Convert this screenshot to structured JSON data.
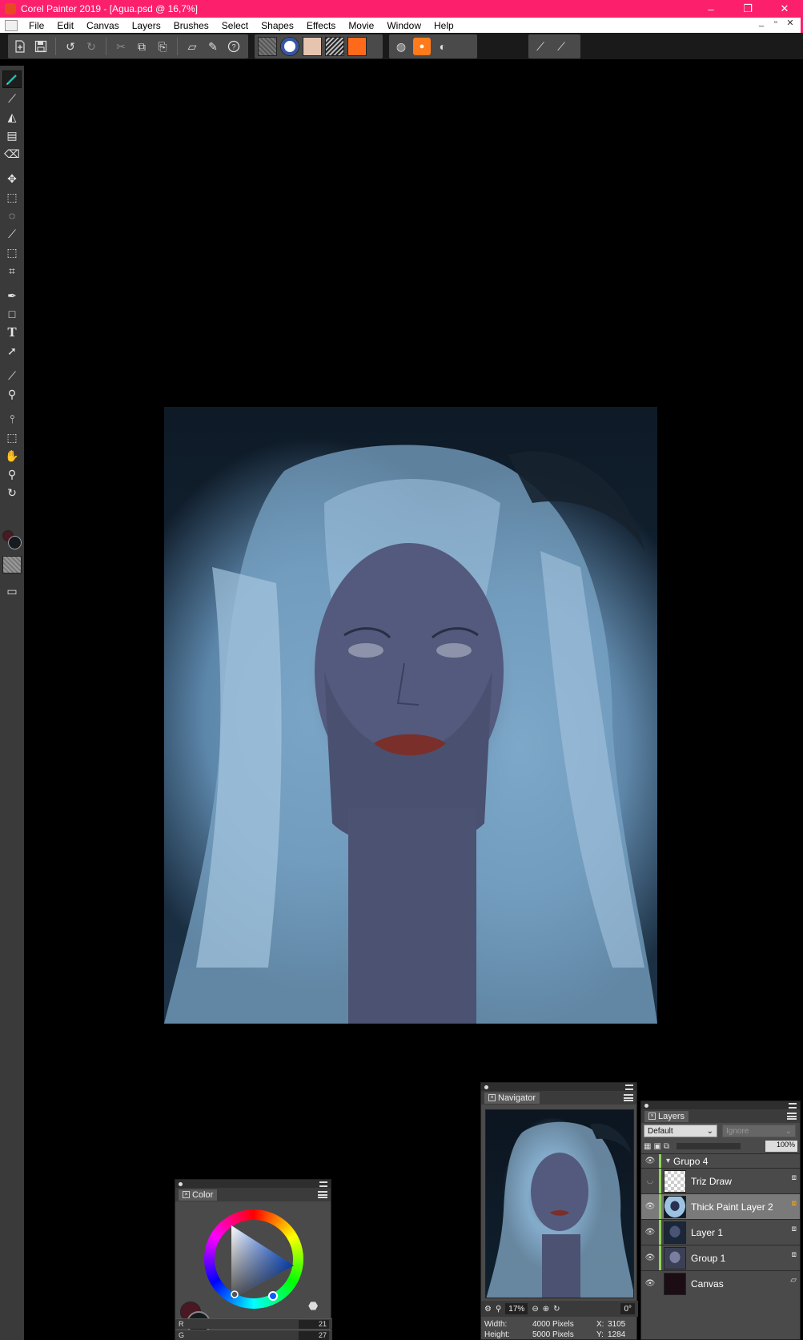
{
  "window": {
    "title": "Corel Painter 2019 - [Agua.psd @ 16,7%]",
    "controls": [
      "–",
      "❐",
      "✕"
    ]
  },
  "menu": [
    "File",
    "Edit",
    "Canvas",
    "Layers",
    "Brushes",
    "Select",
    "Shapes",
    "Effects",
    "Movie",
    "Window",
    "Help"
  ],
  "mdi_controls": [
    "_",
    "▫",
    "✕"
  ],
  "toolbar": {
    "accent_color": "#fb1f6c"
  },
  "color_panel": {
    "tab": "Color",
    "main_color": "#151b1f",
    "secondary_color": "#4a1822",
    "r_label": "R",
    "r_value": "21",
    "g_label": "G",
    "g_value": "27"
  },
  "navigator": {
    "tab": "Navigator",
    "zoom": "17%",
    "rotation": "0°",
    "width_label": "Width:",
    "width_value": "4000 Pixels",
    "height_label": "Height:",
    "height_value": "5000 Pixels",
    "x_label": "X:",
    "x_value": "3105",
    "y_label": "Y:",
    "y_value": "1284"
  },
  "layers": {
    "tab": "Layers",
    "composite": "Default",
    "preserve": "Ignore",
    "opacity": "100%",
    "group_name": "Grupo 4",
    "items": [
      {
        "name": "Triz Draw",
        "visible": false
      },
      {
        "name": "Thick Paint Layer 2",
        "visible": true,
        "selected": true
      },
      {
        "name": "Layer 1",
        "visible": true
      },
      {
        "name": "Group 1",
        "visible": true
      },
      {
        "name": "Canvas",
        "visible": true
      }
    ]
  }
}
